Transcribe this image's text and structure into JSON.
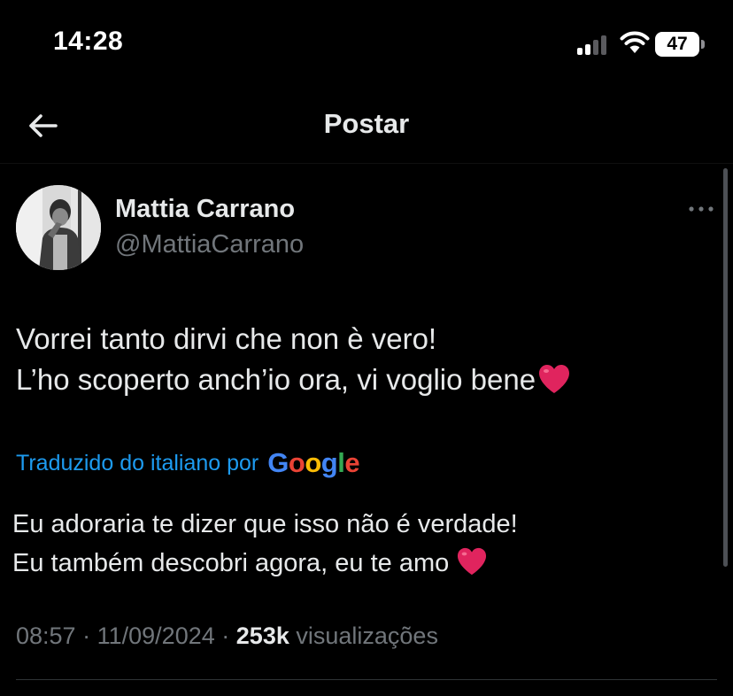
{
  "status_bar": {
    "time": "14:28",
    "battery_level": "47",
    "icons": [
      "cellular-signal-icon",
      "wifi-icon",
      "battery-icon"
    ]
  },
  "nav": {
    "title": "Postar",
    "back_icon": "arrow-left-icon"
  },
  "post": {
    "author_name": "Mattia Carrano",
    "author_handle": "@MattiaCarrano",
    "more_icon": "more-horizontal-icon",
    "text_lines": [
      "Vorrei tanto dirvi che non è vero!",
      "L’ho scoperto anch’io ora, vi voglio bene"
    ],
    "text_emoji": "heart-icon",
    "translated_label": "Traduzido do italiano por",
    "translator_logo": {
      "letters": [
        "G",
        "o",
        "o",
        "g",
        "l",
        "e"
      ],
      "colors": [
        "#4285f4",
        "#ea4335",
        "#fbbc05",
        "#4285f4",
        "#34a853",
        "#ea4335"
      ]
    },
    "translation_lines": [
      "Eu adoraria te dizer que isso não é verdade!",
      "Eu também descobri agora, eu te amo"
    ],
    "time": "08:57",
    "separator": "·",
    "date": "11/09/2024",
    "views_count": "253k",
    "views_label": "visualizações"
  },
  "colors": {
    "background": "#000000",
    "text_primary": "#e7e9ea",
    "text_secondary": "#71767b",
    "link_blue": "#1d9bf0",
    "heart_red": "#e0245e"
  }
}
